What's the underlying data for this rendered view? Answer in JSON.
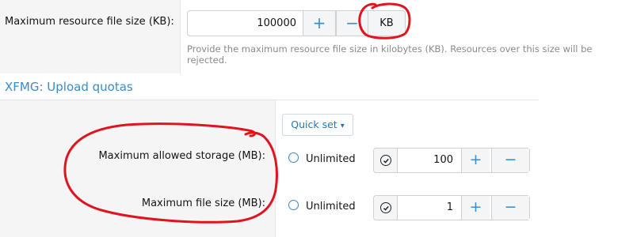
{
  "resource_size": {
    "label": "Maximum resource file size (KB):",
    "value": "100000",
    "plus": "+",
    "minus": "−",
    "unit": "KB",
    "explain": "Provide the maximum resource file size in kilobytes (KB). Resources over this size will be rejected."
  },
  "section": {
    "title": "XFMG: Upload quotas"
  },
  "quick_set": {
    "label": "Quick set",
    "caret": "▾"
  },
  "storage": {
    "label": "Maximum allowed storage (MB):",
    "unlimited_label": "Unlimited",
    "value": "100",
    "plus": "+",
    "minus": "−"
  },
  "file_size": {
    "label": "Maximum file size (MB):",
    "unlimited_label": "Unlimited",
    "value": "1",
    "plus": "+",
    "minus": "−"
  },
  "colors": {
    "accent": "#3a8cc8",
    "annotation": "#e0141d"
  }
}
